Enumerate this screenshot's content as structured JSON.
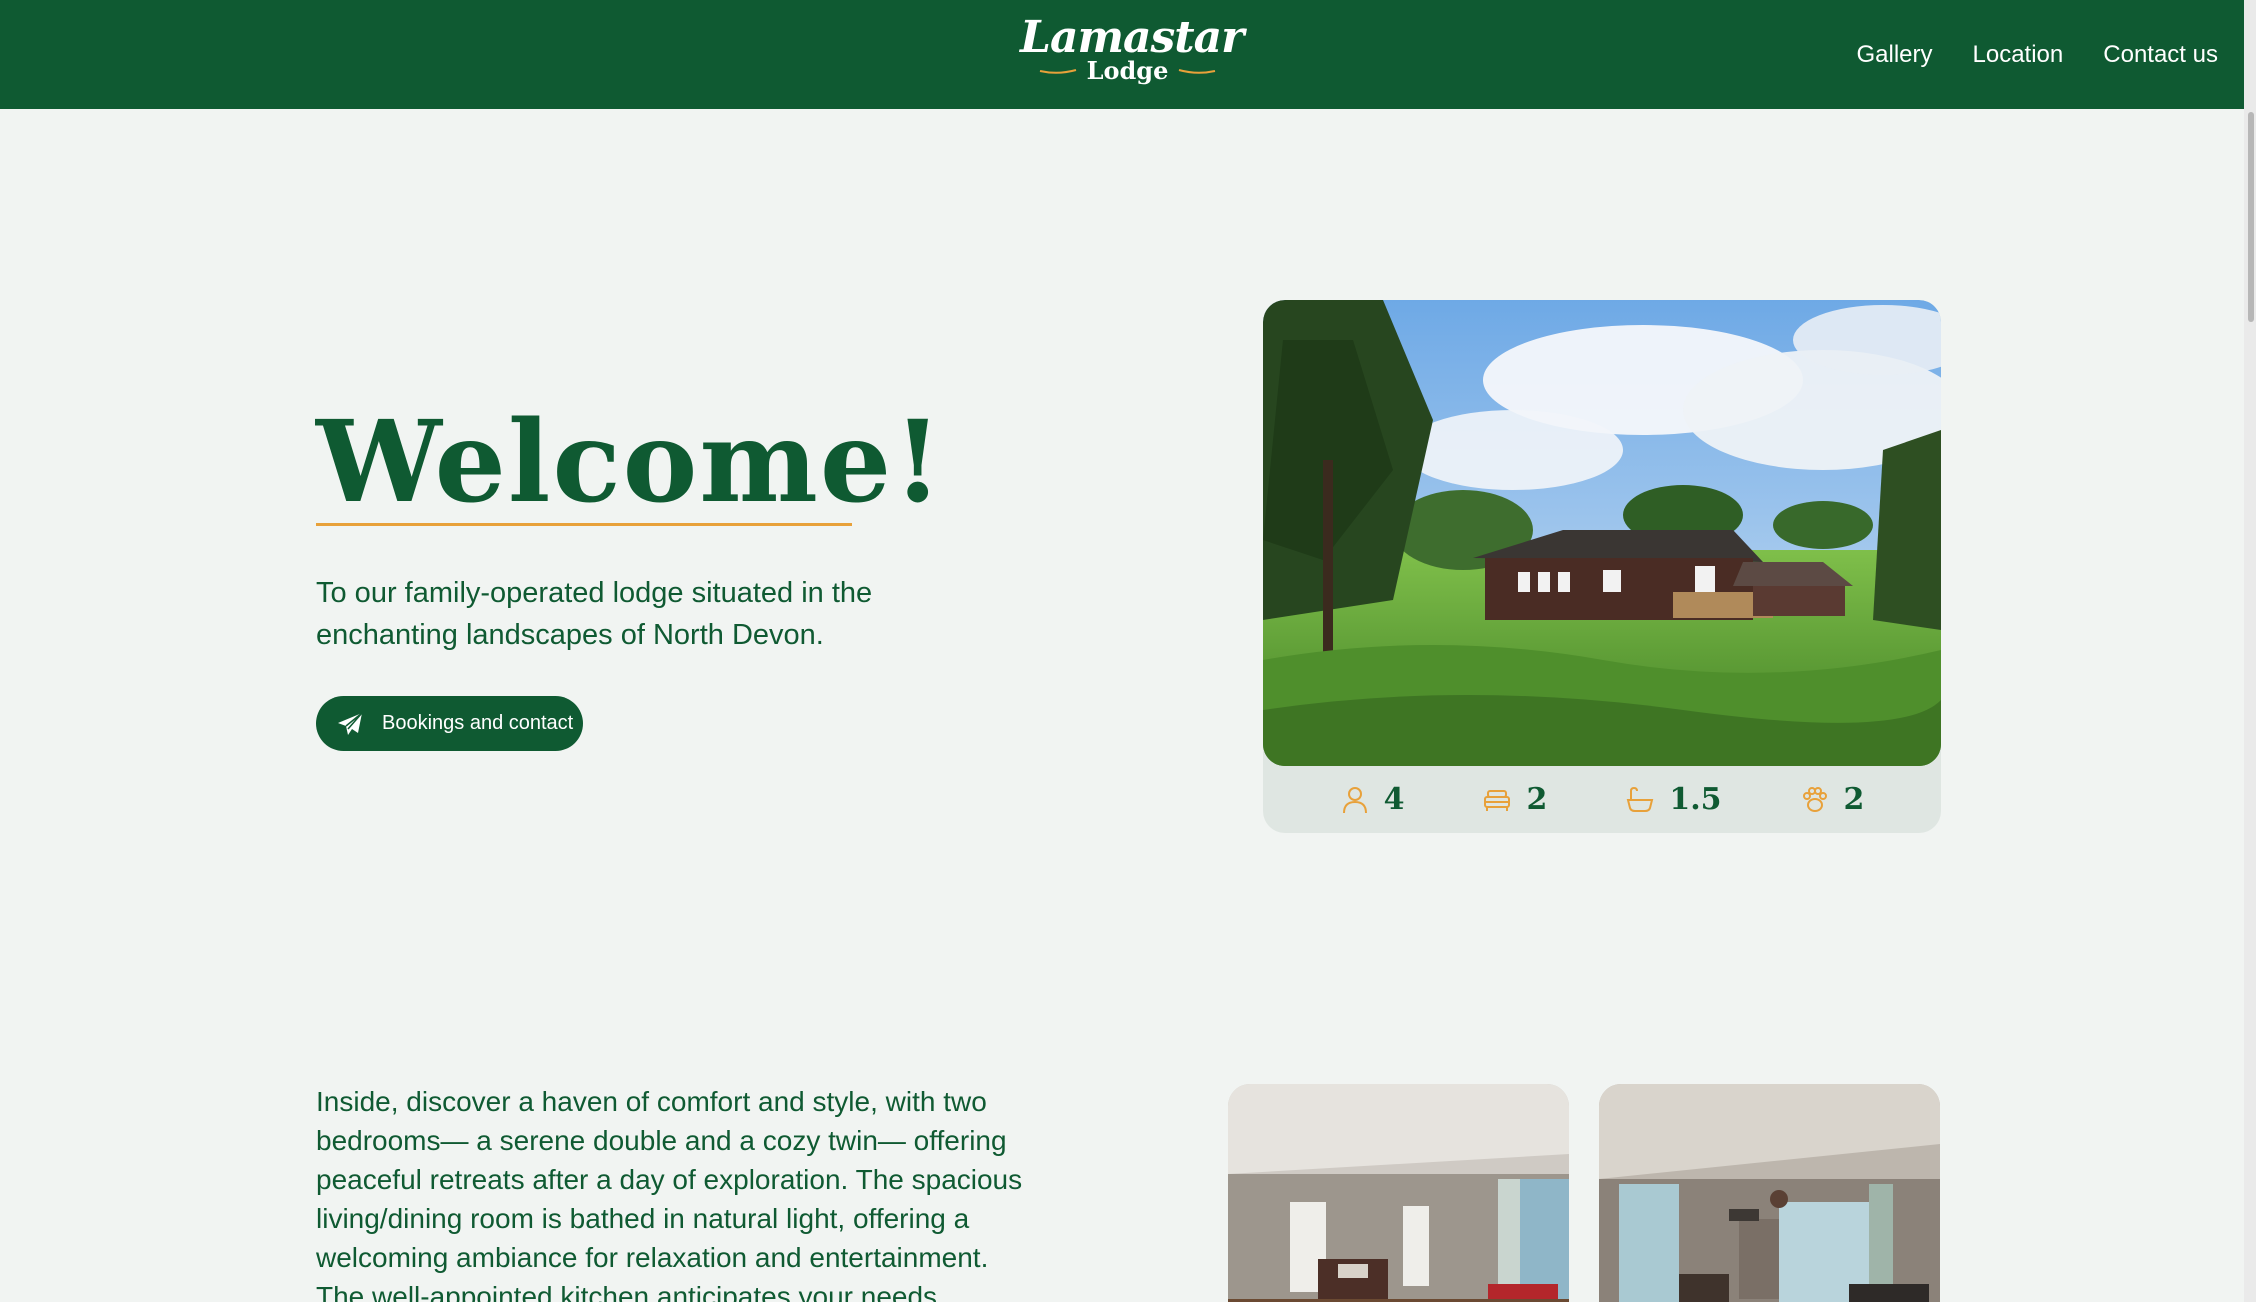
{
  "header": {
    "logo_title": "Lamastar",
    "logo_subtitle": "Lodge",
    "nav": [
      "Gallery",
      "Location",
      "Contact us"
    ]
  },
  "hero": {
    "title": "Welcome!",
    "text": "To our family-operated lodge situated in the enchanting landscapes of North Devon.",
    "cta_label": "Bookings and contact",
    "cta_icon": "paper-plane-icon"
  },
  "stats": [
    {
      "icon": "person-icon",
      "value": "4"
    },
    {
      "icon": "bed-icon",
      "value": "2"
    },
    {
      "icon": "bath-icon",
      "value": "1.5"
    },
    {
      "icon": "paw-icon",
      "value": "2"
    }
  ],
  "about": {
    "text": "Inside, discover a haven of comfort and style, with two bedrooms— a serene double and a cozy twin— offering peaceful retreats after a day of exploration. The spacious living/dining room is bathed in natural light, offering a welcoming ambiance for relaxation and entertainment. The well-appointed kitchen anticipates your needs, ensuring a"
  },
  "colors": {
    "brand_green": "#0f5a32",
    "accent_orange": "#e8a13a",
    "background": "#f1f4f2"
  }
}
